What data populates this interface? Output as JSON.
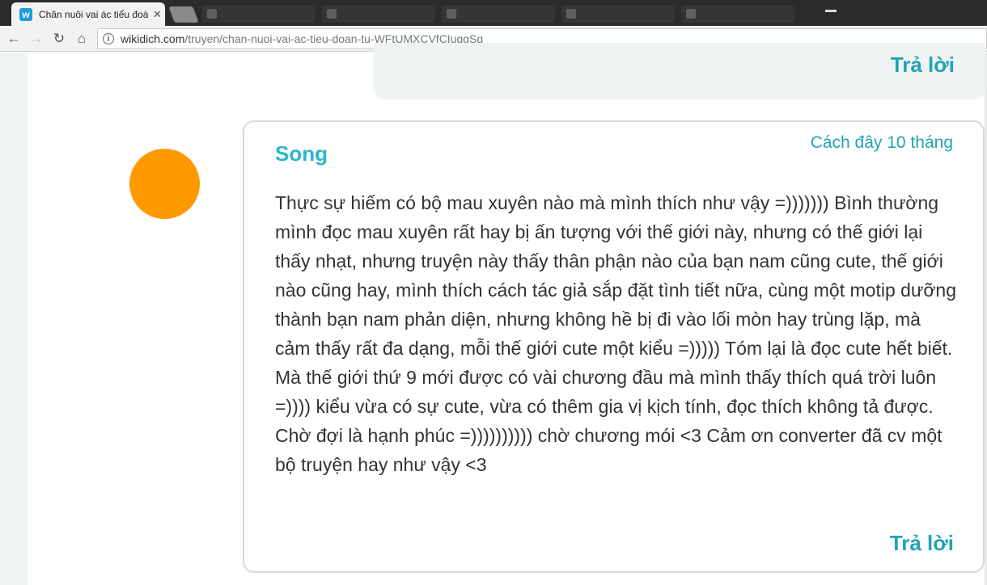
{
  "browser": {
    "tab_title": "Chăn nuôi vai ác tiểu đoà",
    "favicon_letter": "w",
    "url_host": "wikidich.com",
    "url_path": "/truyen/chan-nuoi-vai-ac-tieu-doan-tu-WFtUMXCVfCIuqgSq"
  },
  "previous_comment": {
    "reply_label": "Trả lời"
  },
  "comment": {
    "author": "Song",
    "time": "Cách đây 10 tháng",
    "body": "Thực sự hiếm có bộ mau xuyên nào mà mình thích như vậy =))))))) Bình thường mình đọc mau xuyên rất hay bị ấn tượng với thế giới này, nhưng có thế giới lại thấy nhạt, nhưng truyện này thấy thân phận nào của bạn nam cũng cute, thế giới nào cũng hay, mình thích cách tác giả sắp đặt tình tiết nữa, cùng một motip dưỡng thành bạn nam phản diện, nhưng không hề bị đi vào lối mòn hay trùng lặp, mà cảm thấy rất đa dạng, mỗi thế giới cute một kiểu =))))) Tóm lại là đọc cute hết biết. Mà thế giới thứ 9 mới được có vài chương đầu mà mình thấy thích quá trời luôn =)))) kiểu vừa có sự cute, vừa có thêm gia vị kịch tính, đọc thích không tả được. Chờ đợi là hạnh phúc =)))))))))) chờ chương mói <3 Cảm ơn converter đã cv một bộ truyện hay như vậy <3",
    "reply_label": "Trả lời",
    "avatar_color": "#ff9900"
  },
  "colors": {
    "accent": "#23a3b5",
    "author": "#29b6d1"
  }
}
